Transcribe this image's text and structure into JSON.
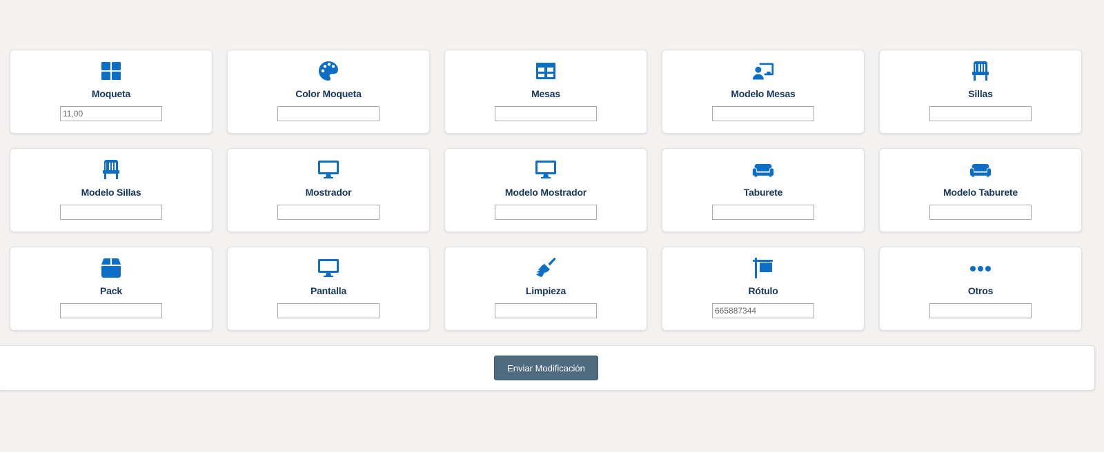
{
  "colors": {
    "accent": "#0d6ec6",
    "label": "#17365d",
    "button": "#4e6b80",
    "background": "#f3f2f1"
  },
  "items": [
    {
      "label": "Moqueta",
      "icon": "grid-icon",
      "value": "11,00"
    },
    {
      "label": "Color Moqueta",
      "icon": "palette-icon",
      "value": ""
    },
    {
      "label": "Mesas",
      "icon": "table-icon",
      "value": ""
    },
    {
      "label": "Modelo Mesas",
      "icon": "chalkboard-user-icon",
      "value": ""
    },
    {
      "label": "Sillas",
      "icon": "chair-icon",
      "value": ""
    },
    {
      "label": "Modelo Sillas",
      "icon": "chair-icon",
      "value": ""
    },
    {
      "label": "Mostrador",
      "icon": "desktop-icon",
      "value": ""
    },
    {
      "label": "Modelo Mostrador",
      "icon": "desktop-icon",
      "value": ""
    },
    {
      "label": "Taburete",
      "icon": "couch-icon",
      "value": ""
    },
    {
      "label": "Modelo Taburete",
      "icon": "couch-icon",
      "value": ""
    },
    {
      "label": "Pack",
      "icon": "box-icon",
      "value": ""
    },
    {
      "label": "Pantalla",
      "icon": "desktop-icon",
      "value": ""
    },
    {
      "label": "Limpieza",
      "icon": "broom-icon",
      "value": ""
    },
    {
      "label": "Rótulo",
      "icon": "sign-icon",
      "value": "665887344"
    },
    {
      "label": "Otros",
      "icon": "ellipsis-icon",
      "value": ""
    }
  ],
  "footer": {
    "submit_label": "Enviar Modificación"
  }
}
